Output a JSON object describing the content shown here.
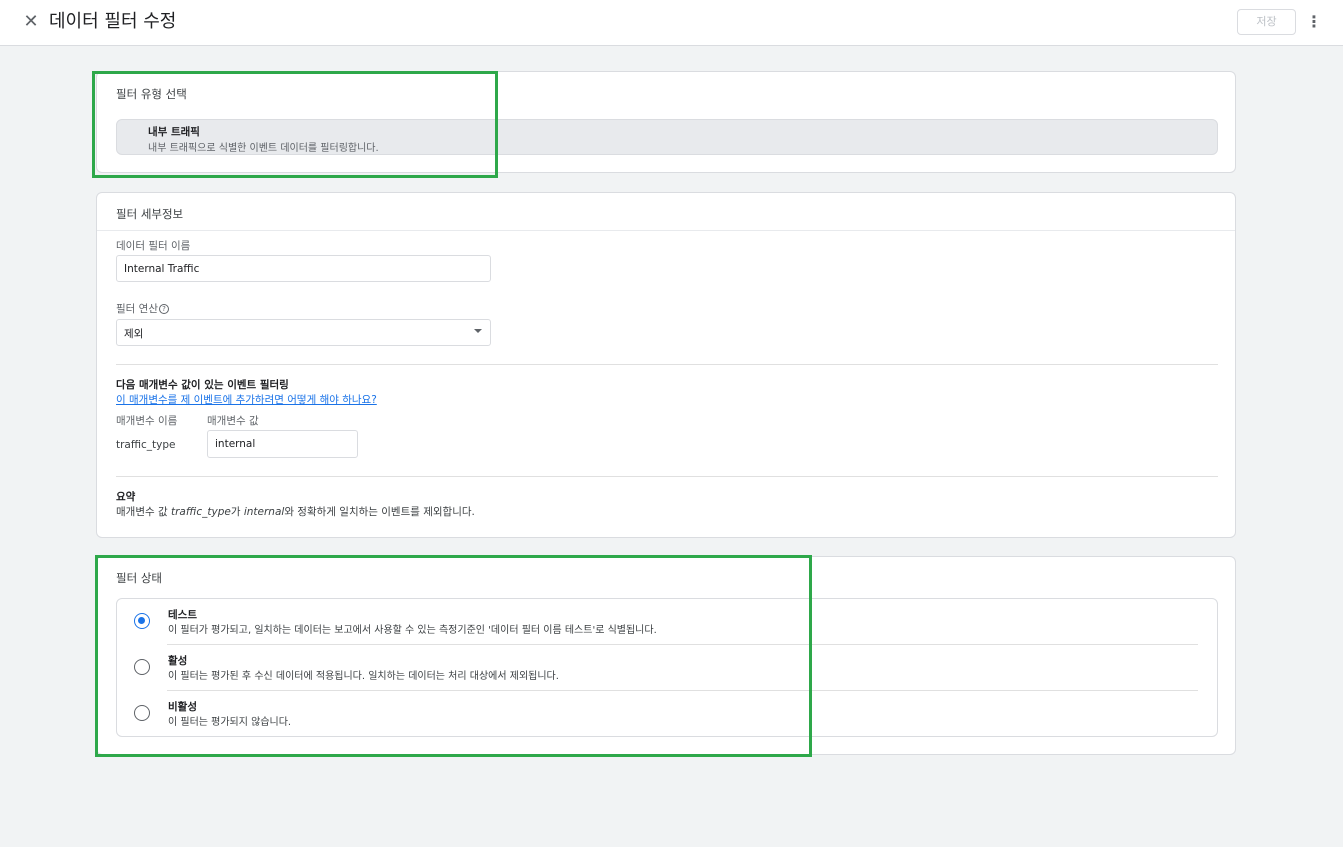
{
  "header": {
    "close_icon": "close-icon",
    "title": "데이터 필터 수정",
    "save_label": "저장",
    "more_icon": "more-vert-icon"
  },
  "filter_type": {
    "section_title": "필터 유형 선택",
    "selected_name": "내부 트래픽",
    "selected_desc": "내부 트래픽으로 식별한 이벤트 데이터를 필터링합니다."
  },
  "details": {
    "section_title": "필터 세부정보",
    "name_label": "데이터 필터 이름",
    "name_value": "Internal Traffic",
    "operation_label": "필터 연산",
    "operation_help_icon": "help-circle-icon",
    "operation_value": "제외",
    "param_heading": "다음 매개변수 값이 있는 이벤트 필터링",
    "param_link": "이 매개변수를 제 이벤트에 추가하려면 어떻게 해야 하나요?",
    "param_name_header": "매개변수 이름",
    "param_value_header": "매개변수 값",
    "param_name": "traffic_type",
    "param_value": "internal",
    "summary_title": "요약",
    "summary_p1": "매개변수 값 ",
    "summary_param": "traffic_type",
    "summary_p2": "가 ",
    "summary_value": "internal",
    "summary_p3": "와 정확하게 일치하는 이벤트를 제외합니다."
  },
  "status": {
    "section_title": "필터 상태",
    "options": [
      {
        "name": "테스트",
        "desc": "이 필터가 평가되고, 일치하는 데이터는 보고에서 사용할 수 있는 측정기준인 '데이터 필터 이름 테스트'로 식별됩니다.",
        "checked": true
      },
      {
        "name": "활성",
        "desc": "이 필터는 평가된 후 수신 데이터에 적용됩니다. 일치하는 데이터는 처리 대상에서 제외됩니다.",
        "checked": false
      },
      {
        "name": "비활성",
        "desc": "이 필터는 평가되지 않습니다.",
        "checked": false
      }
    ]
  },
  "colors": {
    "highlight": "#2ea84a",
    "accent": "#1a73e8"
  }
}
